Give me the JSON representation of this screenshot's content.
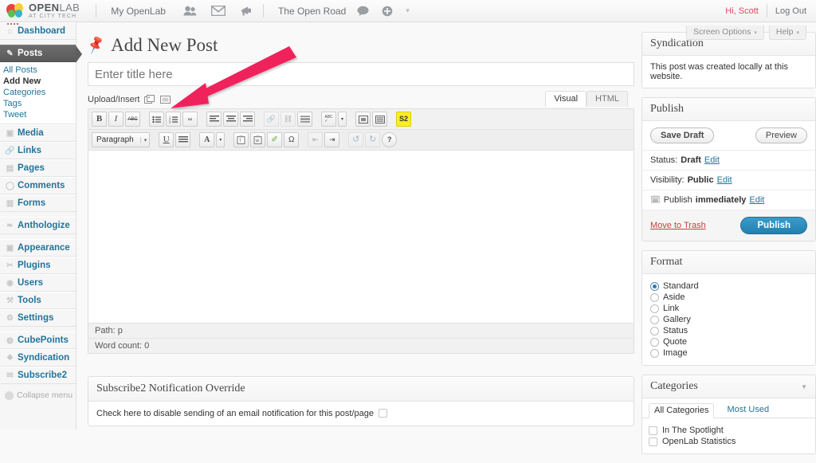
{
  "adminbar": {
    "brand_primary": "OPEN",
    "brand_secondary": "LAB",
    "brand_tagline": "AT CITY TECH",
    "my_openlab": "My OpenLab",
    "site_name": "The Open Road",
    "greeting": "Hi, Scott",
    "logout": "Log Out",
    "icons": [
      "friends-icon",
      "messages-icon",
      "notifications-icon",
      "comments-icon",
      "add-new-icon"
    ]
  },
  "screen_meta": {
    "screen_options": "Screen Options",
    "help": "Help",
    "caret": "▾"
  },
  "sidebar": {
    "items": [
      {
        "label": "Dashboard",
        "icon": "dashboard-icon",
        "current": false
      },
      {
        "label": "Posts",
        "icon": "posts-pin-icon",
        "current": true
      },
      {
        "label": "Media",
        "icon": "media-icon",
        "current": false
      },
      {
        "label": "Links",
        "icon": "links-icon",
        "current": false
      },
      {
        "label": "Pages",
        "icon": "pages-icon",
        "current": false
      },
      {
        "label": "Comments",
        "icon": "comments-icon",
        "current": false
      },
      {
        "label": "Forms",
        "icon": "forms-icon",
        "current": false
      },
      {
        "label": "Anthologize",
        "icon": "anthologize-icon",
        "current": false
      },
      {
        "label": "Appearance",
        "icon": "appearance-icon",
        "current": false
      },
      {
        "label": "Plugins",
        "icon": "plugins-icon",
        "current": false
      },
      {
        "label": "Users",
        "icon": "users-icon",
        "current": false
      },
      {
        "label": "Tools",
        "icon": "tools-icon",
        "current": false
      },
      {
        "label": "Settings",
        "icon": "settings-icon",
        "current": false
      },
      {
        "label": "CubePoints",
        "icon": "cubepoints-icon",
        "current": false
      },
      {
        "label": "Syndication",
        "icon": "syndication-icon",
        "current": false
      },
      {
        "label": "Subscribe2",
        "icon": "subscribe2-icon",
        "current": false
      }
    ],
    "posts_submenu": [
      {
        "label": "All Posts",
        "current": false
      },
      {
        "label": "Add New",
        "current": true
      },
      {
        "label": "Categories",
        "current": false
      },
      {
        "label": "Tags",
        "current": false
      },
      {
        "label": "Tweet",
        "current": false
      }
    ],
    "collapse": "Collapse menu"
  },
  "page": {
    "title": "Add New Post",
    "title_placeholder": "Enter title here",
    "title_value": ""
  },
  "editor": {
    "upload_label": "Upload/Insert",
    "upload_icons": [
      "add-media-icon",
      "add-video-icon"
    ],
    "tabs": [
      {
        "label": "Visual",
        "active": true
      },
      {
        "label": "HTML",
        "active": false
      }
    ],
    "toolbar_row1": [
      {
        "name": "bold-button",
        "glyph": "B",
        "disabled": false
      },
      {
        "name": "italic-button",
        "glyph": "I",
        "disabled": false
      },
      {
        "name": "strikethrough-button",
        "glyph": "ABC",
        "disabled": false
      },
      {
        "name": "bullet-list-button",
        "glyph": "≔",
        "disabled": false
      },
      {
        "name": "numbered-list-button",
        "glyph": "⒈≡",
        "disabled": false
      },
      {
        "name": "blockquote-button",
        "glyph": "❝",
        "disabled": false
      },
      {
        "name": "align-left-button",
        "glyph": "≡",
        "disabled": false
      },
      {
        "name": "align-center-button",
        "glyph": "≡",
        "disabled": false
      },
      {
        "name": "align-right-button",
        "glyph": "≡",
        "disabled": false
      },
      {
        "name": "insert-link-button",
        "glyph": "🔗",
        "disabled": true
      },
      {
        "name": "unlink-button",
        "glyph": "⛓",
        "disabled": true
      },
      {
        "name": "more-tag-button",
        "glyph": "▤",
        "disabled": false
      },
      {
        "name": "spellcheck-button",
        "glyph": "ABC✓",
        "disabled": false
      },
      {
        "name": "fullscreen-button",
        "glyph": "⛶",
        "disabled": false
      },
      {
        "name": "kitchen-sink-button",
        "glyph": "▦",
        "disabled": false
      },
      {
        "name": "subscribe2-token-button",
        "glyph": "S2",
        "disabled": false
      }
    ],
    "format_select": "Paragraph",
    "toolbar_row2": [
      {
        "name": "underline-button",
        "glyph": "U",
        "disabled": false
      },
      {
        "name": "justify-button",
        "glyph": "≣",
        "disabled": false
      },
      {
        "name": "text-color-button",
        "glyph": "A",
        "disabled": false
      },
      {
        "name": "paste-as-text-button",
        "glyph": "📋",
        "disabled": false
      },
      {
        "name": "paste-from-word-button",
        "glyph": "📋",
        "disabled": false
      },
      {
        "name": "remove-formatting-button",
        "glyph": "✐",
        "disabled": false
      },
      {
        "name": "special-character-button",
        "glyph": "Ω",
        "disabled": false
      },
      {
        "name": "outdent-button",
        "glyph": "⇤",
        "disabled": true
      },
      {
        "name": "indent-button",
        "glyph": "⇥",
        "disabled": false
      },
      {
        "name": "undo-button",
        "glyph": "↺",
        "disabled": true
      },
      {
        "name": "redo-button",
        "glyph": "↻",
        "disabled": true
      },
      {
        "name": "help-button",
        "glyph": "?",
        "disabled": false
      }
    ],
    "path": "Path: p",
    "word_count": "Word count: 0"
  },
  "subscribe2_box": {
    "title": "Subscribe2 Notification Override",
    "checkbox_label": "Check here to disable sending of an email notification for this post/page"
  },
  "syndication_box": {
    "title": "Syndication",
    "text": "This post was created locally at this website."
  },
  "publish_box": {
    "title": "Publish",
    "save_draft": "Save Draft",
    "preview": "Preview",
    "status_label": "Status:",
    "status_value": "Draft",
    "status_edit": "Edit",
    "visibility_label": "Visibility:",
    "visibility_value": "Public",
    "visibility_edit": "Edit",
    "schedule_label": "Publish",
    "schedule_value": "immediately",
    "schedule_edit": "Edit",
    "trash": "Move to Trash",
    "publish": "Publish"
  },
  "format_box": {
    "title": "Format",
    "options": [
      {
        "label": "Standard",
        "selected": true
      },
      {
        "label": "Aside",
        "selected": false
      },
      {
        "label": "Link",
        "selected": false
      },
      {
        "label": "Gallery",
        "selected": false
      },
      {
        "label": "Status",
        "selected": false
      },
      {
        "label": "Quote",
        "selected": false
      },
      {
        "label": "Image",
        "selected": false
      }
    ]
  },
  "categories_box": {
    "title": "Categories",
    "tabs": [
      {
        "label": "All Categories",
        "active": true
      },
      {
        "label": "Most Used",
        "active": false
      }
    ],
    "items": [
      {
        "label": "In The Spotlight",
        "checked": false
      },
      {
        "label": "OpenLab Statistics",
        "checked": false
      }
    ]
  },
  "annotation": {
    "type": "arrow",
    "color": "#f0215c",
    "points_from": "top-right",
    "points_to": "upload-insert-icons"
  }
}
